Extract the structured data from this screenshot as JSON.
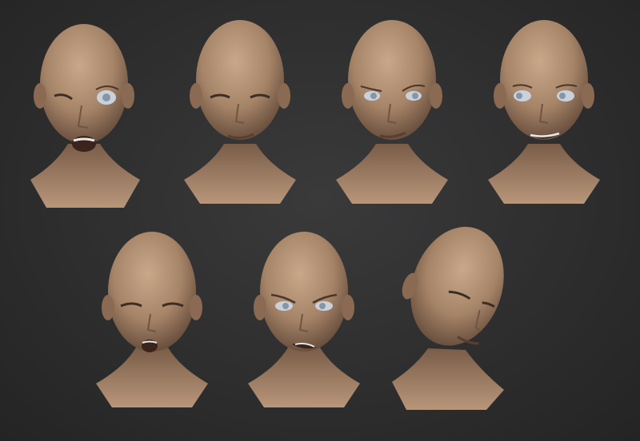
{
  "colors": {
    "background": "#2e2e2f",
    "skin": "#a68468",
    "skin_shadow": "#6f5542",
    "skin_highlight": "#c9a88a",
    "eye": "#c9d2dc",
    "iris": "#8796a6"
  },
  "heads": [
    {
      "expression": "wink-open-mouth"
    },
    {
      "expression": "eyes-closed-smirk"
    },
    {
      "expression": "raised-brow-smirk"
    },
    {
      "expression": "side-glance-grin"
    },
    {
      "expression": "eyes-closed-surprised"
    },
    {
      "expression": "angry-glare"
    },
    {
      "expression": "tilted-eyes-closed"
    }
  ]
}
